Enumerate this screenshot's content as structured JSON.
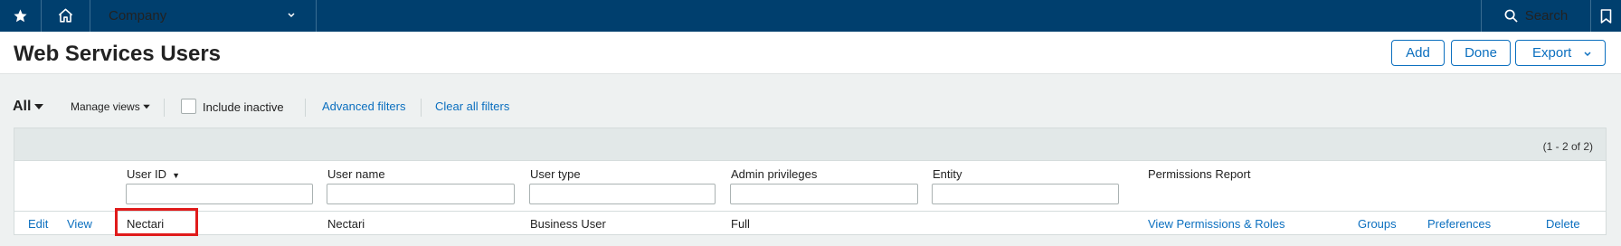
{
  "nav": {
    "company_label": "Company",
    "search_label": "Search"
  },
  "header": {
    "title": "Web Services Users",
    "add_label": "Add",
    "done_label": "Done",
    "export_label": "Export"
  },
  "filters": {
    "view_label": "All",
    "manage_views_label": "Manage views",
    "include_inactive_label": "Include inactive",
    "include_inactive_checked": false,
    "advanced_filters_label": "Advanced filters",
    "clear_filters_label": "Clear all filters"
  },
  "table": {
    "count_text": "(1 - 2 of 2)",
    "columns": {
      "user_id": "User ID",
      "user_name": "User name",
      "user_type": "User type",
      "admin_privileges": "Admin privileges",
      "entity": "Entity",
      "permissions_report": "Permissions Report"
    },
    "rows": [
      {
        "edit": "Edit",
        "view": "View",
        "user_id": "Nectari",
        "user_name": "Nectari",
        "user_type": "Business User",
        "admin_privileges": "Full",
        "entity": "",
        "permissions": "View Permissions & Roles",
        "groups": "Groups",
        "preferences": "Preferences",
        "delete": "Delete"
      }
    ]
  },
  "colors": {
    "nav_bg": "#003f6e",
    "link": "#0b6fbf",
    "highlight": "#e01b1b"
  }
}
